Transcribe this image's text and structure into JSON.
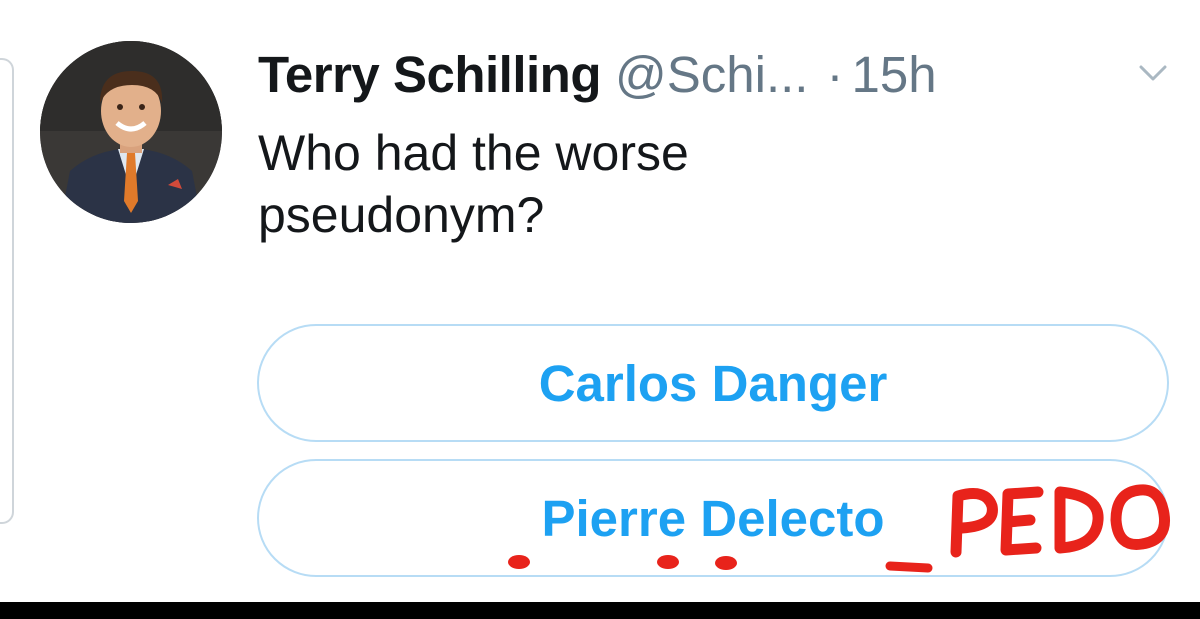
{
  "tweet": {
    "display_name": "Terry Schilling",
    "handle": "@Schi...",
    "separator": "·",
    "time": "15h",
    "text": "Who had the worse pseudonym?",
    "avatar_icon": "profile-photo",
    "menu_icon": "chevron-down-icon"
  },
  "poll": {
    "options": [
      {
        "label": "Carlos Danger"
      },
      {
        "label": "Pierre Delecto"
      }
    ]
  },
  "annotation": {
    "handwritten_text": "PEDO",
    "color": "#e8231b"
  },
  "colors": {
    "accent": "#1da1f2",
    "text": "#14171a",
    "secondary": "#657786",
    "poll_border": "#b7dcf5"
  }
}
